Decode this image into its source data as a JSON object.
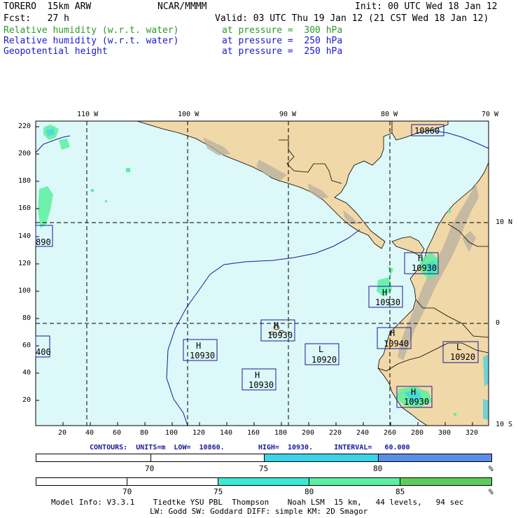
{
  "header": {
    "model": "TORERO  15km ARW",
    "org": "NCAR/MMMM",
    "init": "Init: 00 UTC Wed 18 Jan 12",
    "fcst": "Fcst:   27 h",
    "valid": "Valid: 03 UTC Thu 19 Jan 12 (21 CST Wed 18 Jan 12)",
    "fields": [
      {
        "name": "Relative humidity (w.r.t. water)",
        "level": "at pressure =  300 hPa",
        "color": "#2b9a2b"
      },
      {
        "name": "Relative humidity (w.r.t. water)",
        "level": "at pressure =  250 hPa",
        "color": "#1a1ad0"
      },
      {
        "name": "Geopotential height",
        "level": "at pressure =  250 hPa",
        "color": "#1a1ad0"
      }
    ]
  },
  "map": {
    "ocean_color": "#dcf8f8",
    "land_color": "#f0d8a8",
    "top_lon_labels": [
      "110 W",
      "100 W",
      "90 W",
      "80 W",
      "70 W"
    ],
    "right_lat_labels": [
      "10 N",
      "0",
      "10 S"
    ],
    "left_ticks": [
      "220",
      "200",
      "180",
      "160",
      "140",
      "120",
      "100",
      "80",
      "60",
      "40",
      "20"
    ],
    "bottom_ticks": [
      "20",
      "40",
      "60",
      "80",
      "100",
      "120",
      "140",
      "160",
      "180",
      "200",
      "220",
      "240",
      "260",
      "280",
      "300",
      "320"
    ],
    "centers": [
      {
        "type": "",
        "value": "10860"
      },
      {
        "type": "",
        "value": "890"
      },
      {
        "type": "H",
        "value": "10930"
      },
      {
        "type": "H",
        "value": "10930"
      },
      {
        "type": "H",
        "value": "10930"
      },
      {
        "type": "H",
        "value": "10940"
      },
      {
        "type": "",
        "value": "400"
      },
      {
        "type": "H",
        "value": "10930"
      },
      {
        "type": "L",
        "value": "10920"
      },
      {
        "type": "L",
        "value": "10920"
      },
      {
        "type": "H",
        "value": "10930"
      },
      {
        "type": "H",
        "value": "10930"
      }
    ]
  },
  "contours_text": "CONTOURS:  UNITS=m  LOW=  10860.        HIGH=  10930.     INTERVAL=   60.000",
  "colorbar_250": {
    "labels": [
      "70",
      "75",
      "80",
      "%"
    ],
    "colors": [
      "#ffffff",
      "#ffffff",
      "#3cd2e8",
      "#5a8ee6"
    ]
  },
  "colorbar_300": {
    "labels": [
      "70",
      "75",
      "80",
      "85",
      "%"
    ],
    "colors": [
      "#ffffff",
      "#ffffff",
      "#3ce8d2",
      "#5af0a0",
      "#5acd5a"
    ]
  },
  "footer": {
    "line1": "Model Info: V3.3.1    Tiedtke YSU PBL  Thompson    Noah LSM  15 km,   44 levels,   94 sec",
    "line2": "LW: Godd SW: Goddard DIFF: simple KM: 2D Smagor"
  }
}
